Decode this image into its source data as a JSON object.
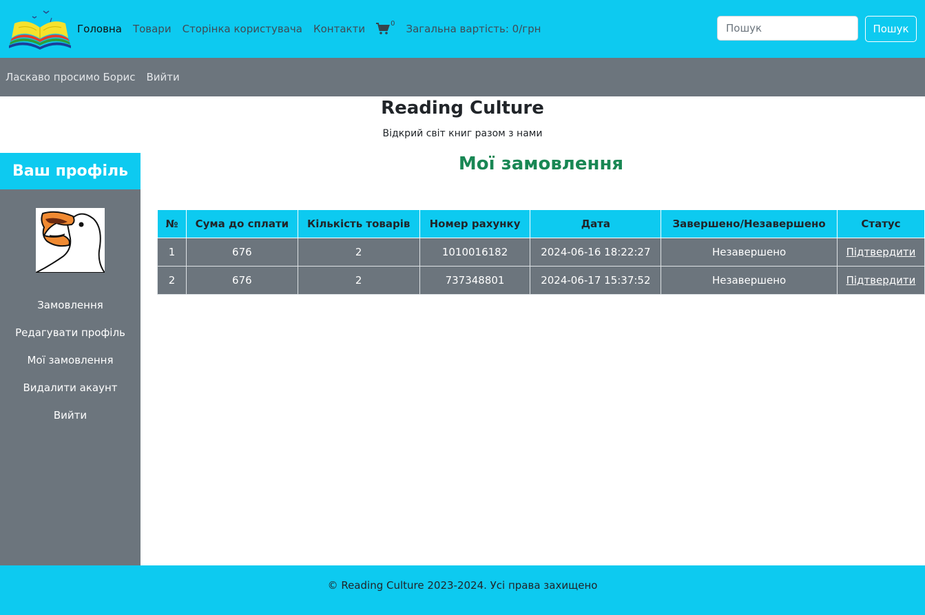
{
  "nav": {
    "links": [
      "Головна",
      "Товари",
      "Сторінка користувача",
      "Контакти"
    ],
    "cart_count": "0",
    "total_label": "Загальна вартість: 0/грн",
    "search_placeholder": "Пошук",
    "search_button": "Пошук"
  },
  "subbar": {
    "welcome": "Ласкаво просимо Борис",
    "logout": "Вийти"
  },
  "header": {
    "title": "Reading Culture",
    "subtitle": "Відкрий світ книг разом з нами"
  },
  "sidebar": {
    "title": "Ваш профіль",
    "items": [
      "Замовлення",
      "Редагувати профіль",
      "Мої замовлення",
      "Видалити акаунт",
      "Вийти"
    ]
  },
  "main": {
    "title": "Мої замовлення",
    "columns": [
      "№",
      "Сума до сплати",
      "Кількість товарів",
      "Номер рахунку",
      "Дата",
      "Завершено/Незавершено",
      "Статус"
    ],
    "rows": [
      [
        "1",
        "676",
        "2",
        "1010016182",
        "2024-06-16 18:22:27",
        "Незавершено",
        "Підтвердити"
      ],
      [
        "2",
        "676",
        "2",
        "737348801",
        "2024-06-17 15:37:52",
        "Незавершено",
        "Підтвердити"
      ]
    ]
  },
  "footer": {
    "text": "© Reading Culture 2023-2024. Усі права захищено"
  },
  "colors": {
    "accent": "#0dcaf0",
    "secondary": "#6c757d",
    "heading_green": "#198754"
  },
  "icons": [
    "book-logo-icon",
    "cart-icon",
    "avatar-goose-icon"
  ]
}
